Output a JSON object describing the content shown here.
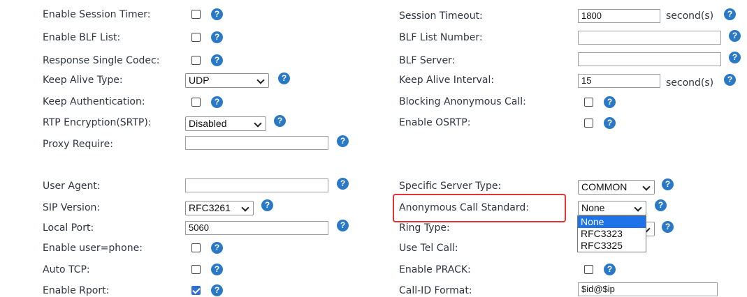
{
  "left": {
    "enable_session_timer": "Enable Session Timer:",
    "enable_blf_list": "Enable BLF List:",
    "response_single_codec": "Response Single Codec:",
    "keep_alive_type": "Keep Alive Type:",
    "keep_alive_type_value": "UDP",
    "keep_authentication": "Keep Authentication:",
    "rtp_encryption": "RTP Encryption(SRTP):",
    "rtp_encryption_value": "Disabled",
    "proxy_require": "Proxy Require:",
    "proxy_require_value": "",
    "user_agent": "User Agent:",
    "user_agent_value": "",
    "sip_version": "SIP Version:",
    "sip_version_value": "RFC3261",
    "local_port": "Local Port:",
    "local_port_value": "5060",
    "enable_user_phone": "Enable user=phone:",
    "auto_tcp": "Auto TCP:",
    "enable_rport": "Enable Rport:",
    "enable_rport_checked": true
  },
  "right": {
    "session_timeout": "Session Timeout:",
    "session_timeout_value": "1800",
    "session_timeout_unit": "second(s)",
    "blf_list_number": "BLF List Number:",
    "blf_list_number_value": "",
    "blf_server": "BLF Server:",
    "blf_server_value": "",
    "keep_alive_interval": "Keep Alive Interval:",
    "keep_alive_interval_value": "15",
    "keep_alive_interval_unit": "second(s)",
    "blocking_anonymous_call": "Blocking Anonymous Call:",
    "enable_osrtp": "Enable OSRTP:",
    "specific_server_type": "Specific Server Type:",
    "specific_server_type_value": "COMMON",
    "anonymous_call_standard": "Anonymous Call Standard:",
    "anonymous_call_standard_value": "None",
    "ring_type": "Ring Type:",
    "use_tel_call": "Use Tel Call:",
    "enable_prack": "Enable PRACK:",
    "call_id_format": "Call-ID Format:",
    "call_id_format_value": "$id@$ip"
  },
  "dropdown_options": [
    "None",
    "RFC3323",
    "RFC3325"
  ],
  "help_glyph": "?",
  "colors": {
    "help_icon": "#2a79c7",
    "highlight_box": "#e23434",
    "selected_option": "#1e73e8"
  }
}
